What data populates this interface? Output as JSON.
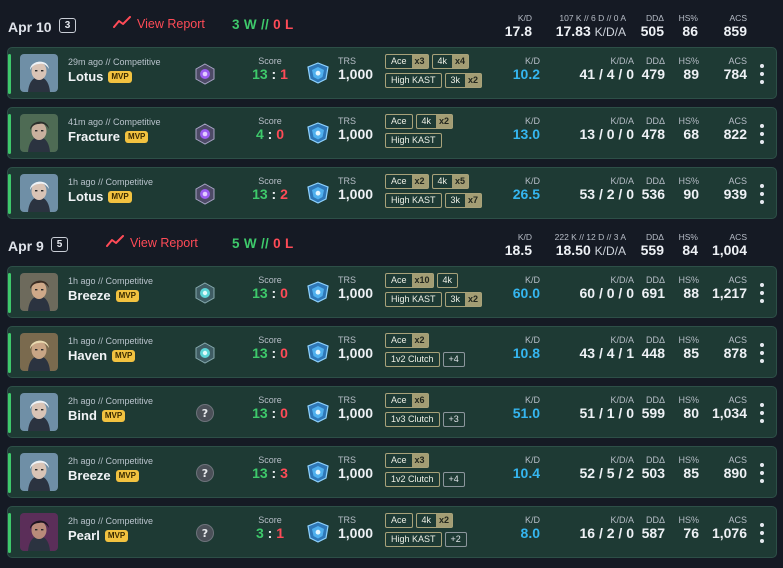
{
  "colors": {
    "win": "#3ec96b",
    "loss": "#ff4b57",
    "kd_highlight": "#35b6f0",
    "row_bg": "#1e3a34",
    "mvp": "#f2c240"
  },
  "days": [
    {
      "date": "Apr 10",
      "count": "3",
      "view_report": "View Report",
      "wins": "3 W",
      "sep": "//",
      "losses": "0 L",
      "summary": {
        "kd_label": "K/D",
        "kd": "17.8",
        "kda_label": "107 K // 6 D // 0 A",
        "kda": "17.83",
        "kda_unit": "K/D/A",
        "dd_label": "DDΔ",
        "dd": "505",
        "hs_label": "HS%",
        "hs": "86",
        "acs_label": "ACS",
        "acs": "859"
      },
      "matches": [
        {
          "meta": "29m ago // Competitive",
          "map": "Lotus",
          "mvp": "MVP",
          "agent": "jett",
          "rank_icon": "radiant-purple-icon",
          "score_label": "Score",
          "score_a": "13",
          "score_b": "1",
          "trs_label": "TRS",
          "trs": "1,000",
          "badges": [
            [
              {
                "label": "Ace",
                "mult": "x3"
              },
              {
                "label": "4k",
                "mult": "x4"
              }
            ],
            [
              {
                "label": "High KAST",
                "mult": ""
              },
              {
                "label": "3k",
                "mult": "x2"
              }
            ]
          ],
          "kd_label": "K/D",
          "kd": "10.2",
          "kda_label": "K/D/A",
          "kda": "41 / 4 / 0",
          "dd_label": "DDΔ",
          "dd": "479",
          "hs_label": "HS%",
          "hs": "89",
          "acs_label": "ACS",
          "acs": "784"
        },
        {
          "meta": "41m ago // Competitive",
          "map": "Fracture",
          "mvp": "MVP",
          "agent": "viper",
          "rank_icon": "radiant-purple-icon",
          "score_label": "Score",
          "score_a": "4",
          "score_b": "0",
          "trs_label": "TRS",
          "trs": "1,000",
          "badges": [
            [
              {
                "label": "Ace",
                "mult": ""
              },
              {
                "label": "4k",
                "mult": "x2"
              }
            ],
            [
              {
                "label": "High KAST",
                "mult": ""
              }
            ]
          ],
          "kd_label": "K/D",
          "kd": "13.0",
          "kda_label": "K/D/A",
          "kda": "13 / 0 / 0",
          "dd_label": "DDΔ",
          "dd": "478",
          "hs_label": "HS%",
          "hs": "68",
          "acs_label": "ACS",
          "acs": "822"
        },
        {
          "meta": "1h ago // Competitive",
          "map": "Lotus",
          "mvp": "MVP",
          "agent": "jett",
          "rank_icon": "radiant-purple-icon",
          "score_label": "Score",
          "score_a": "13",
          "score_b": "2",
          "trs_label": "TRS",
          "trs": "1,000",
          "badges": [
            [
              {
                "label": "Ace",
                "mult": "x2"
              },
              {
                "label": "4k",
                "mult": "x5"
              }
            ],
            [
              {
                "label": "High KAST",
                "mult": ""
              },
              {
                "label": "3k",
                "mult": "x7"
              }
            ]
          ],
          "kd_label": "K/D",
          "kd": "26.5",
          "kda_label": "K/D/A",
          "kda": "53 / 2 / 0",
          "dd_label": "DDΔ",
          "dd": "536",
          "hs_label": "HS%",
          "hs": "90",
          "acs_label": "ACS",
          "acs": "939"
        }
      ]
    },
    {
      "date": "Apr 9",
      "count": "5",
      "view_report": "View Report",
      "wins": "5 W",
      "sep": "//",
      "losses": "0 L",
      "summary": {
        "kd_label": "K/D",
        "kd": "18.5",
        "kda_label": "222 K // 12 D // 3 A",
        "kda": "18.50",
        "kda_unit": "K/D/A",
        "dd_label": "DDΔ",
        "dd": "559",
        "hs_label": "HS%",
        "hs": "84",
        "acs_label": "ACS",
        "acs": "1,004"
      },
      "matches": [
        {
          "meta": "1h ago // Competitive",
          "map": "Breeze",
          "mvp": "MVP",
          "agent": "chamber",
          "rank_icon": "immortal-teal-icon",
          "score_label": "Score",
          "score_a": "13",
          "score_b": "0",
          "trs_label": "TRS",
          "trs": "1,000",
          "badges": [
            [
              {
                "label": "Ace",
                "mult": "x10"
              },
              {
                "label": "4k",
                "mult": ""
              }
            ],
            [
              {
                "label": "High KAST",
                "mult": ""
              },
              {
                "label": "3k",
                "mult": "x2"
              }
            ]
          ],
          "kd_label": "K/D",
          "kd": "60.0",
          "kda_label": "K/D/A",
          "kda": "60 / 0 / 0",
          "dd_label": "DDΔ",
          "dd": "691",
          "hs_label": "HS%",
          "hs": "88",
          "acs_label": "ACS",
          "acs": "1,217"
        },
        {
          "meta": "1h ago // Competitive",
          "map": "Haven",
          "mvp": "MVP",
          "agent": "sova",
          "rank_icon": "immortal-teal-icon",
          "score_label": "Score",
          "score_a": "13",
          "score_b": "0",
          "trs_label": "TRS",
          "trs": "1,000",
          "badges": [
            [
              {
                "label": "Ace",
                "mult": "x2"
              }
            ],
            [
              {
                "label": "1v2 Clutch",
                "mult": ""
              },
              {
                "label": "+4",
                "mult": "",
                "more": true
              }
            ]
          ],
          "kd_label": "K/D",
          "kd": "10.8",
          "kda_label": "K/D/A",
          "kda": "43 / 4 / 1",
          "dd_label": "DDΔ",
          "dd": "448",
          "hs_label": "HS%",
          "hs": "85",
          "acs_label": "ACS",
          "acs": "878"
        },
        {
          "meta": "2h ago // Competitive",
          "map": "Bind",
          "mvp": "MVP",
          "agent": "jett",
          "rank_icon": "unknown-rank-icon",
          "score_label": "Score",
          "score_a": "13",
          "score_b": "0",
          "trs_label": "TRS",
          "trs": "1,000",
          "badges": [
            [
              {
                "label": "Ace",
                "mult": "x6"
              }
            ],
            [
              {
                "label": "1v3 Clutch",
                "mult": ""
              },
              {
                "label": "+3",
                "mult": "",
                "more": true
              }
            ]
          ],
          "kd_label": "K/D",
          "kd": "51.0",
          "kda_label": "K/D/A",
          "kda": "51 / 1 / 0",
          "dd_label": "DDΔ",
          "dd": "599",
          "hs_label": "HS%",
          "hs": "80",
          "acs_label": "ACS",
          "acs": "1,034"
        },
        {
          "meta": "2h ago // Competitive",
          "map": "Breeze",
          "mvp": "MVP",
          "agent": "jett",
          "rank_icon": "unknown-rank-icon",
          "score_label": "Score",
          "score_a": "13",
          "score_b": "3",
          "trs_label": "TRS",
          "trs": "1,000",
          "badges": [
            [
              {
                "label": "Ace",
                "mult": "x3"
              }
            ],
            [
              {
                "label": "1v2 Clutch",
                "mult": ""
              },
              {
                "label": "+4",
                "mult": "",
                "more": true
              }
            ]
          ],
          "kd_label": "K/D",
          "kd": "10.4",
          "kda_label": "K/D/A",
          "kda": "52 / 5 / 2",
          "dd_label": "DDΔ",
          "dd": "503",
          "hs_label": "HS%",
          "hs": "85",
          "acs_label": "ACS",
          "acs": "890"
        },
        {
          "meta": "2h ago // Competitive",
          "map": "Pearl",
          "mvp": "MVP",
          "agent": "reyna",
          "rank_icon": "unknown-rank-icon",
          "score_label": "Score",
          "score_a": "3",
          "score_b": "1",
          "trs_label": "TRS",
          "trs": "1,000",
          "badges": [
            [
              {
                "label": "Ace",
                "mult": ""
              },
              {
                "label": "4k",
                "mult": "x2"
              }
            ],
            [
              {
                "label": "High KAST",
                "mult": ""
              },
              {
                "label": "+2",
                "mult": "",
                "more": true
              }
            ]
          ],
          "kd_label": "K/D",
          "kd": "8.0",
          "kda_label": "K/D/A",
          "kda": "16 / 2 / 0",
          "dd_label": "DDΔ",
          "dd": "587",
          "hs_label": "HS%",
          "hs": "76",
          "acs_label": "ACS",
          "acs": "1,076"
        }
      ]
    }
  ]
}
